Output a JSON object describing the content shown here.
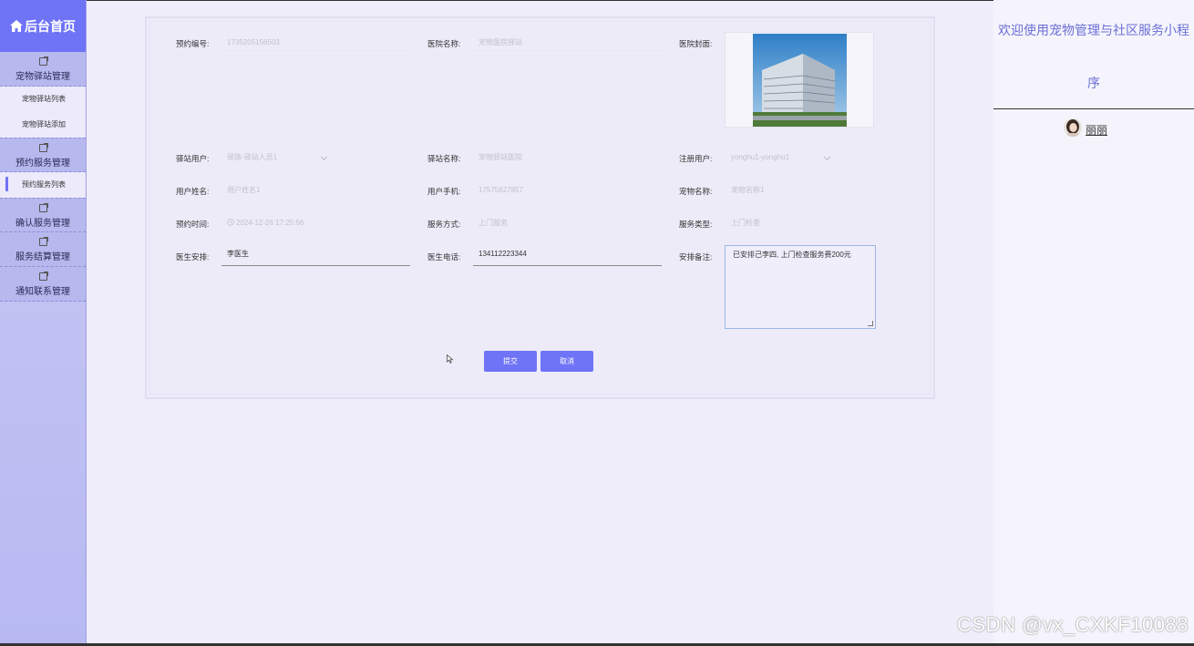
{
  "sidebar": {
    "home_label": "后台首页",
    "groups": [
      {
        "label": "宠物驿站管理",
        "items": [
          "宠物驿站列表",
          "宠物驿站添加"
        ]
      },
      {
        "label": "预约服务管理",
        "items": [
          "预约服务列表"
        ]
      },
      {
        "label": "确认服务管理"
      },
      {
        "label": "服务结算管理"
      },
      {
        "label": "通知联系管理"
      }
    ]
  },
  "form": {
    "booking_no": {
      "label": "预约编号:",
      "value": "1735205156503"
    },
    "hospital_name": {
      "label": "医院名称:",
      "value": "宠物医院驿站"
    },
    "hospital_cover": {
      "label": "医院封面:"
    },
    "station_user": {
      "label": "驿站用户:",
      "value": "驿路-驿站人员1"
    },
    "station_name": {
      "label": "驿站名称:",
      "value": "宠物驿站医院"
    },
    "registered_user": {
      "label": "注册用户:",
      "value": "yonghu1-yonghu1"
    },
    "user_name": {
      "label": "用户姓名:",
      "value": "用户姓名1"
    },
    "user_phone": {
      "label": "用户手机:",
      "value": "17575627857"
    },
    "pet_name": {
      "label": "宠物名称:",
      "value": "宠物名称1"
    },
    "booking_time": {
      "label": "预约时间:",
      "value": "2024-12-26 17:25:56"
    },
    "service_method": {
      "label": "服务方式:",
      "value": "上门服务"
    },
    "service_type": {
      "label": "服务类型:",
      "value": "上门检查"
    },
    "doctor": {
      "label": "医生安排:",
      "value": "李医生"
    },
    "doctor_phone": {
      "label": "医生电话:",
      "value": "134112223344"
    },
    "remark": {
      "label": "安排备注:",
      "value": "已安排己李四, 上门检查服务费200元"
    },
    "submit_label": "提交",
    "cancel_label": "取消"
  },
  "right_pane": {
    "welcome_line1": "欢迎使用宠物管理与社区服务小程",
    "welcome_line2": "序",
    "username": "丽丽"
  },
  "watermark": "CSDN @vx_CXKF10088",
  "colors": {
    "accent": "#6f73f5",
    "sidebar": "#c0c1f3",
    "background": "#f1eefb"
  }
}
